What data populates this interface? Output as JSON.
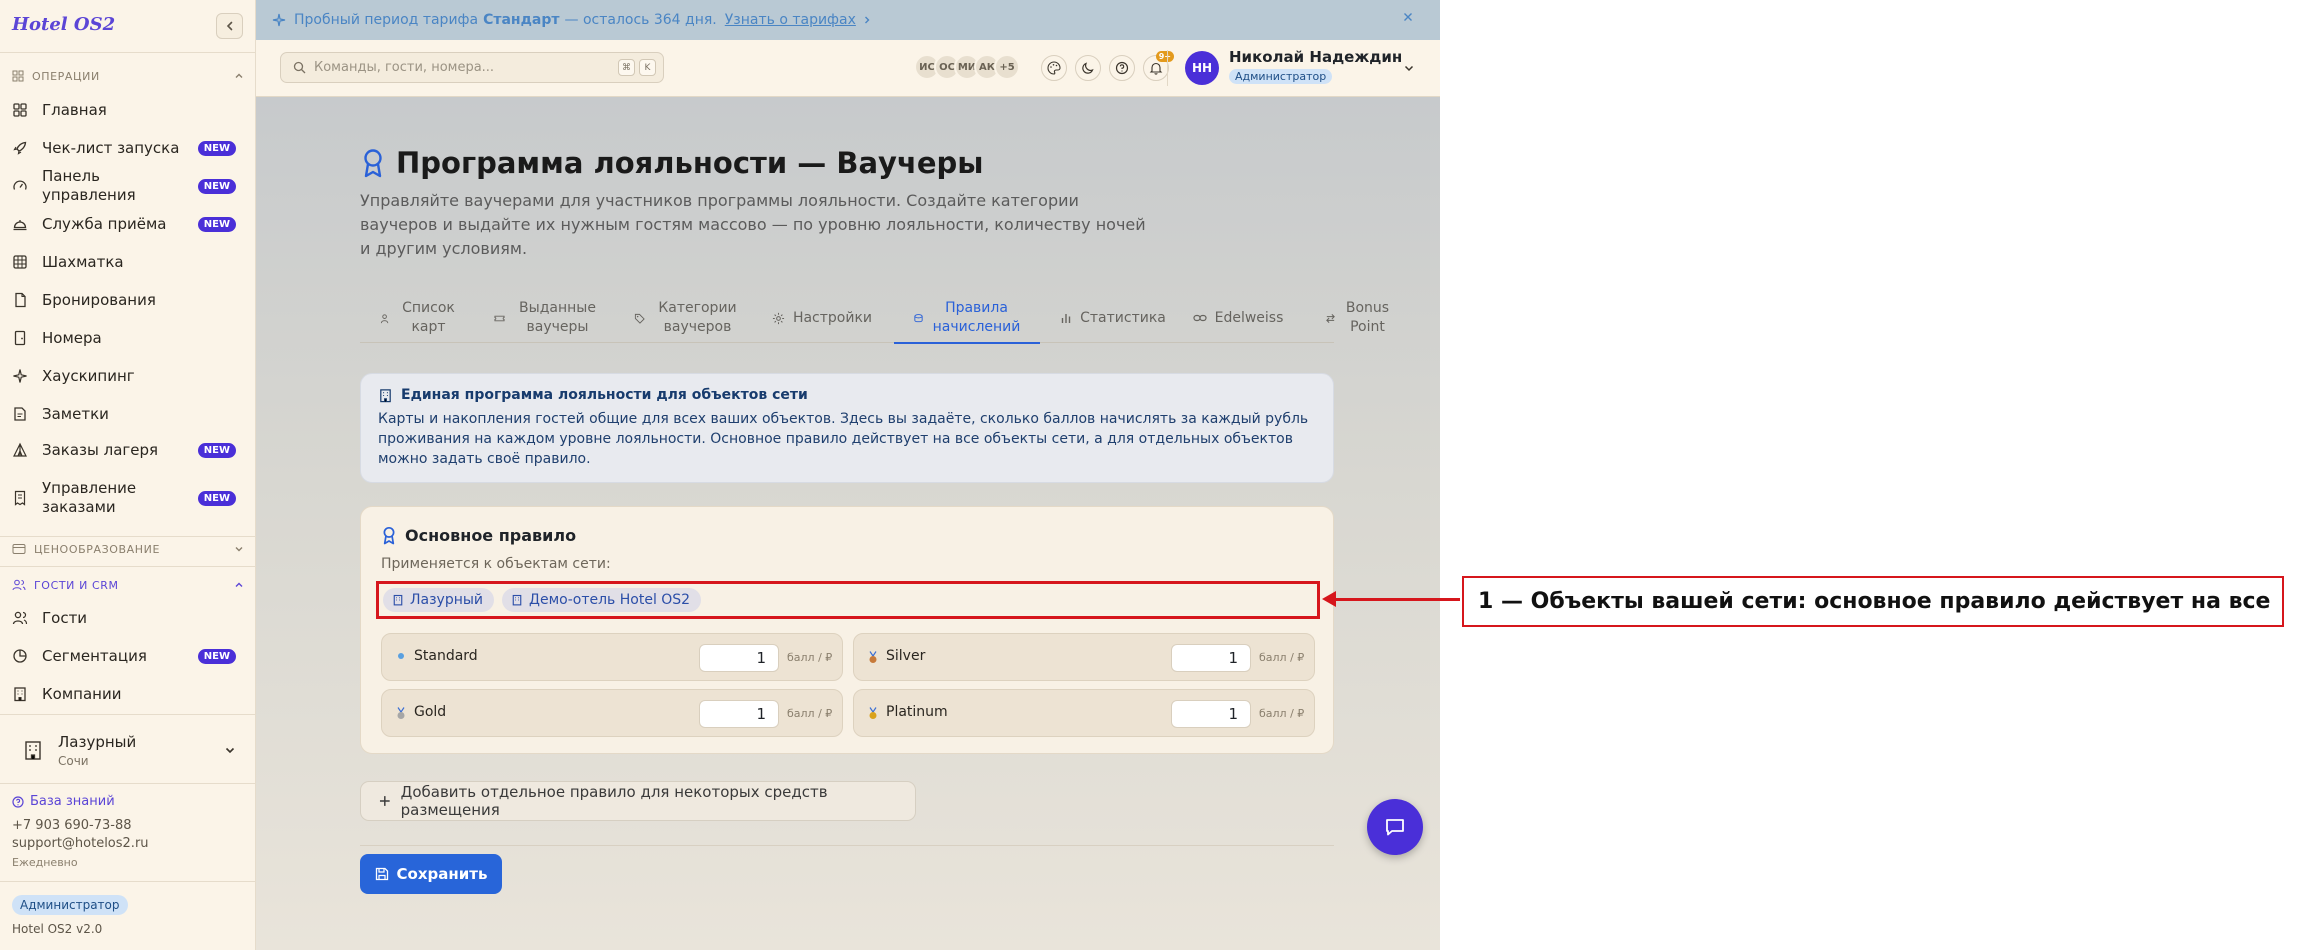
{
  "sidebar": {
    "brand": "Hotel OS2",
    "sections": {
      "operations": "ОПЕРАЦИИ",
      "pricing": "ЦЕНООБРАЗОВАНИЕ",
      "crm": "ГОСТИ И CRM"
    },
    "new_badge": "NEW",
    "items": [
      {
        "label": "Главная",
        "icon": "grid-icon",
        "badge": ""
      },
      {
        "label": "Чек-лист запуска",
        "icon": "rocket-icon",
        "badge": "NEW"
      },
      {
        "label": "Панель управления",
        "icon": "gauge-icon",
        "badge": "NEW"
      },
      {
        "label": "Служба приёма",
        "icon": "bell-service-icon",
        "badge": "NEW"
      },
      {
        "label": "Шахматка",
        "icon": "table-icon",
        "badge": ""
      },
      {
        "label": "Бронирования",
        "icon": "document-icon",
        "badge": ""
      },
      {
        "label": "Номера",
        "icon": "door-icon",
        "badge": ""
      },
      {
        "label": "Хаускипинг",
        "icon": "sparkle-icon",
        "badge": ""
      },
      {
        "label": "Заметки",
        "icon": "note-icon",
        "badge": ""
      },
      {
        "label": "Заказы лагеря",
        "icon": "tent-icon",
        "badge": "NEW"
      },
      {
        "label": "Управление заказами",
        "icon": "receipt-icon",
        "badge": "NEW"
      },
      {
        "label": "Гости",
        "icon": "users-icon",
        "badge": ""
      },
      {
        "label": "Сегментация",
        "icon": "pie-icon",
        "badge": "NEW"
      },
      {
        "label": "Компании",
        "icon": "building-icon",
        "badge": ""
      }
    ],
    "hotel": {
      "name": "Лазурный",
      "city": "Сочи"
    },
    "knowledge_base": "База знаний",
    "phone": "+7 903 690-73-88",
    "email": "support@hotelos2.ru",
    "schedule": "Ежедневно",
    "role": "Администратор",
    "version": "Hotel OS2 v2.0"
  },
  "trial": {
    "prefix": "Пробный период тарифа",
    "plan": "Стандарт",
    "suffix": "— осталось 364 дня.",
    "link": "Узнать о тарифах"
  },
  "topbar": {
    "search_placeholder": "Команды, гости, номера...",
    "kbd": [
      "⌘",
      "K"
    ],
    "avatars": [
      "ИС",
      "ОС",
      "МИ",
      "АК",
      "+5"
    ],
    "notif_count": "9+",
    "user_initials": "НН",
    "user_name": "Николай Надеждин",
    "user_role": "Администратор"
  },
  "main": {
    "title": "Программа лояльности — Ваучеры",
    "description": "Управляйте ваучерами для участников программы лояльности. Создайте категории ваучеров и выдайте их нужным гостям массово — по уровню лояльности, количеству ночей и другим условиям.",
    "tabs": [
      {
        "label": "Список карт",
        "icon": "users-icon"
      },
      {
        "label": "Выданные ваучеры",
        "icon": "ticket-icon"
      },
      {
        "label": "Категории ваучеров",
        "icon": "tag-icon"
      },
      {
        "label": "Настройки",
        "icon": "gear-icon"
      },
      {
        "label": "Правила начислений",
        "icon": "coins-icon"
      },
      {
        "label": "Статистика",
        "icon": "bar-chart-icon"
      },
      {
        "label": "Edelweiss",
        "icon": "link-icon"
      },
      {
        "label": "Bonus Point",
        "icon": "arrows-icon"
      }
    ],
    "info": {
      "title": "Единая программа лояльности для объектов сети",
      "text": "Карты и накопления гостей общие для всех ваших объектов. Здесь вы задаёте, сколько баллов начислять за каждый рубль проживания на каждом уровне лояльности. Основное правило действует на все объекты сети, а для отдельных объектов можно задать своё правило."
    },
    "rule": {
      "title": "Основное правило",
      "subtitle": "Применяется к объектам сети:",
      "properties": [
        "Лазурный",
        "Демо-отель Hotel OS2"
      ],
      "unit": "балл / ₽",
      "tiers": [
        {
          "name": "Standard",
          "value": "1",
          "color": "#5aa0e0"
        },
        {
          "name": "Silver",
          "value": "1",
          "color": "#c77a3a"
        },
        {
          "name": "Gold",
          "value": "1",
          "color": "#a6a6a6"
        },
        {
          "name": "Platinum",
          "value": "1",
          "color": "#d9a21d"
        }
      ]
    },
    "add_rule": "Добавить отдельное правило для некоторых средств размещения",
    "save": "Сохранить"
  },
  "annotation": "1 — Объекты вашей сети: основное правило действует на все"
}
